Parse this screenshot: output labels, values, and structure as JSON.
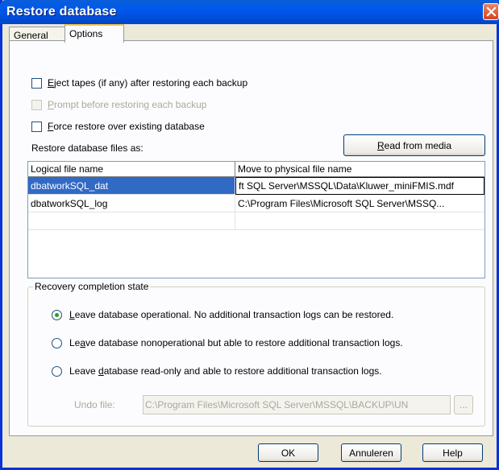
{
  "window": {
    "title": "Restore database"
  },
  "tabs": [
    {
      "label": "General",
      "active": false
    },
    {
      "label": "Options",
      "active": true
    }
  ],
  "options": {
    "eject_tapes": {
      "mn": "E",
      "rest": "ject tapes (if any) after restoring each backup",
      "checked": false,
      "enabled": true
    },
    "prompt_before": {
      "mn": "P",
      "rest": "rompt before restoring each backup",
      "checked": false,
      "enabled": false
    },
    "force_restore": {
      "mn": "F",
      "rest": "orce restore over existing database",
      "checked": false,
      "enabled": true
    }
  },
  "files_section": {
    "label": "Restore database files as:",
    "read_from_media": {
      "mn": "R",
      "rest": "ead from media"
    }
  },
  "files_table": {
    "columns": [
      "Logical file name",
      "Move to physical file name"
    ],
    "rows": [
      {
        "logical": "dbatworkSQL_dat",
        "physical": "ft SQL Server\\MSSQL\\Data\\Kluwer_miniFMIS.mdf",
        "selected": true
      },
      {
        "logical": "dbatworkSQL_log",
        "physical": "C:\\Program Files\\Microsoft SQL Server\\MSSQ...",
        "selected": false
      }
    ]
  },
  "recovery": {
    "legend": "Recovery completion state",
    "options": [
      {
        "pre": "",
        "mn": "L",
        "rest": "eave database operational. No additional transaction logs can be restored.",
        "checked": true
      },
      {
        "pre": "Le",
        "mn": "a",
        "rest": "ve database nonoperational but able to restore additional transaction logs.",
        "checked": false
      },
      {
        "pre": "Leave ",
        "mn": "d",
        "rest": "atabase read-only and able to restore additional transaction logs.",
        "checked": false
      }
    ],
    "undo_label": "Undo file:",
    "undo_value": "C:\\Program Files\\Microsoft SQL Server\\MSSQL\\BACKUP\\UN",
    "browse_label": "..."
  },
  "buttons": {
    "ok": "OK",
    "cancel": "Annuleren",
    "help": "Help"
  },
  "colors": {
    "titlebar": "#0058ee",
    "dialog_bg": "#ece9d8",
    "selection": "#316ac5",
    "radio_dot": "#21a121"
  },
  "icons": {
    "close": "close-icon"
  }
}
